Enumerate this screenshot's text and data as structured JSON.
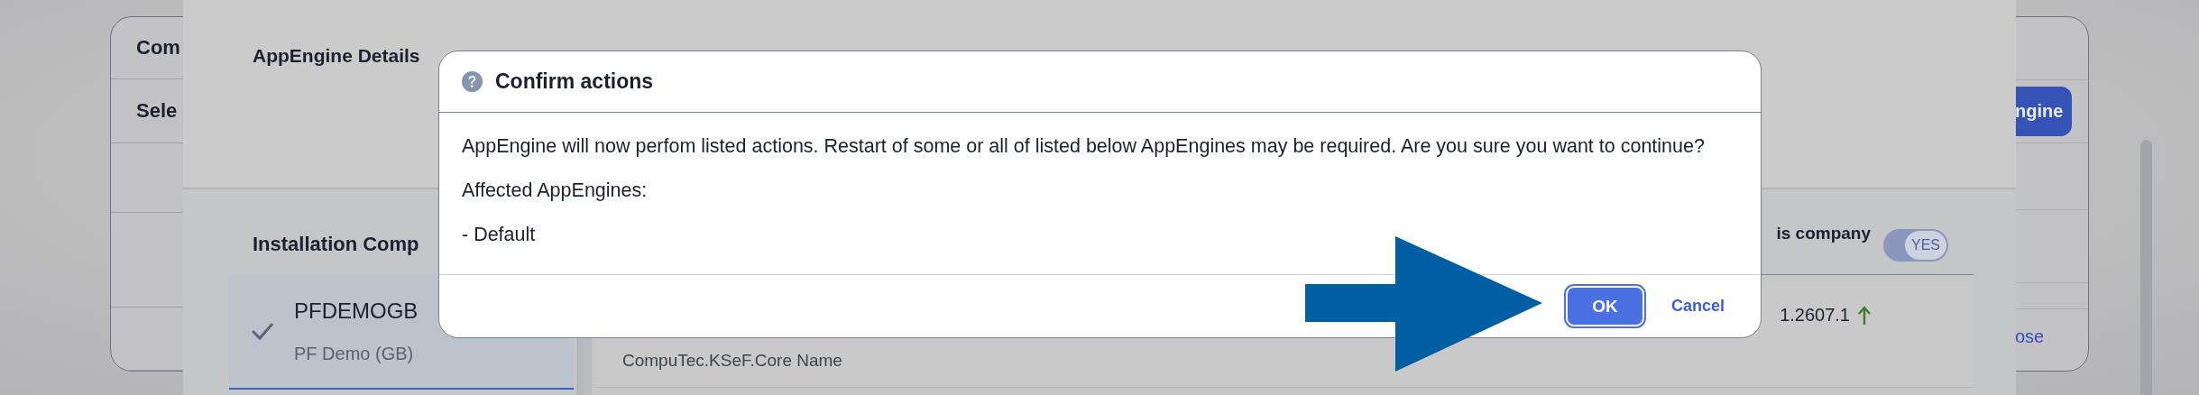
{
  "background_page": {
    "sections": [
      {
        "title": "Com"
      },
      {
        "title": "Sele"
      }
    ],
    "action_button": {
      "label": "ngine"
    },
    "link": {
      "label": "ose"
    }
  },
  "details_panel": {
    "title": "AppEngine Details",
    "companies_title": "Installation Comp",
    "companies": [
      {
        "code": "PFDEMOGB",
        "name": "PF Demo (GB)",
        "selected": true
      }
    ],
    "column_header": "is company",
    "toggle": {
      "label": "YES",
      "on": true
    },
    "rows": [
      {
        "name": "CompuTec.KSeF.Core Name",
        "version": "1.2607.1",
        "update_available": true
      }
    ]
  },
  "dialog": {
    "title": "Confirm actions",
    "message": "AppEngine will now perfom listed actions. Restart of some or all of listed below AppEngines may be required. Are you sure you want to continue?",
    "affected_label": "Affected AppEngines:",
    "affected": [
      "- Default"
    ],
    "buttons": [
      {
        "label": "OK",
        "kind": "primary"
      },
      {
        "label": "Cancel",
        "kind": "link"
      }
    ]
  }
}
